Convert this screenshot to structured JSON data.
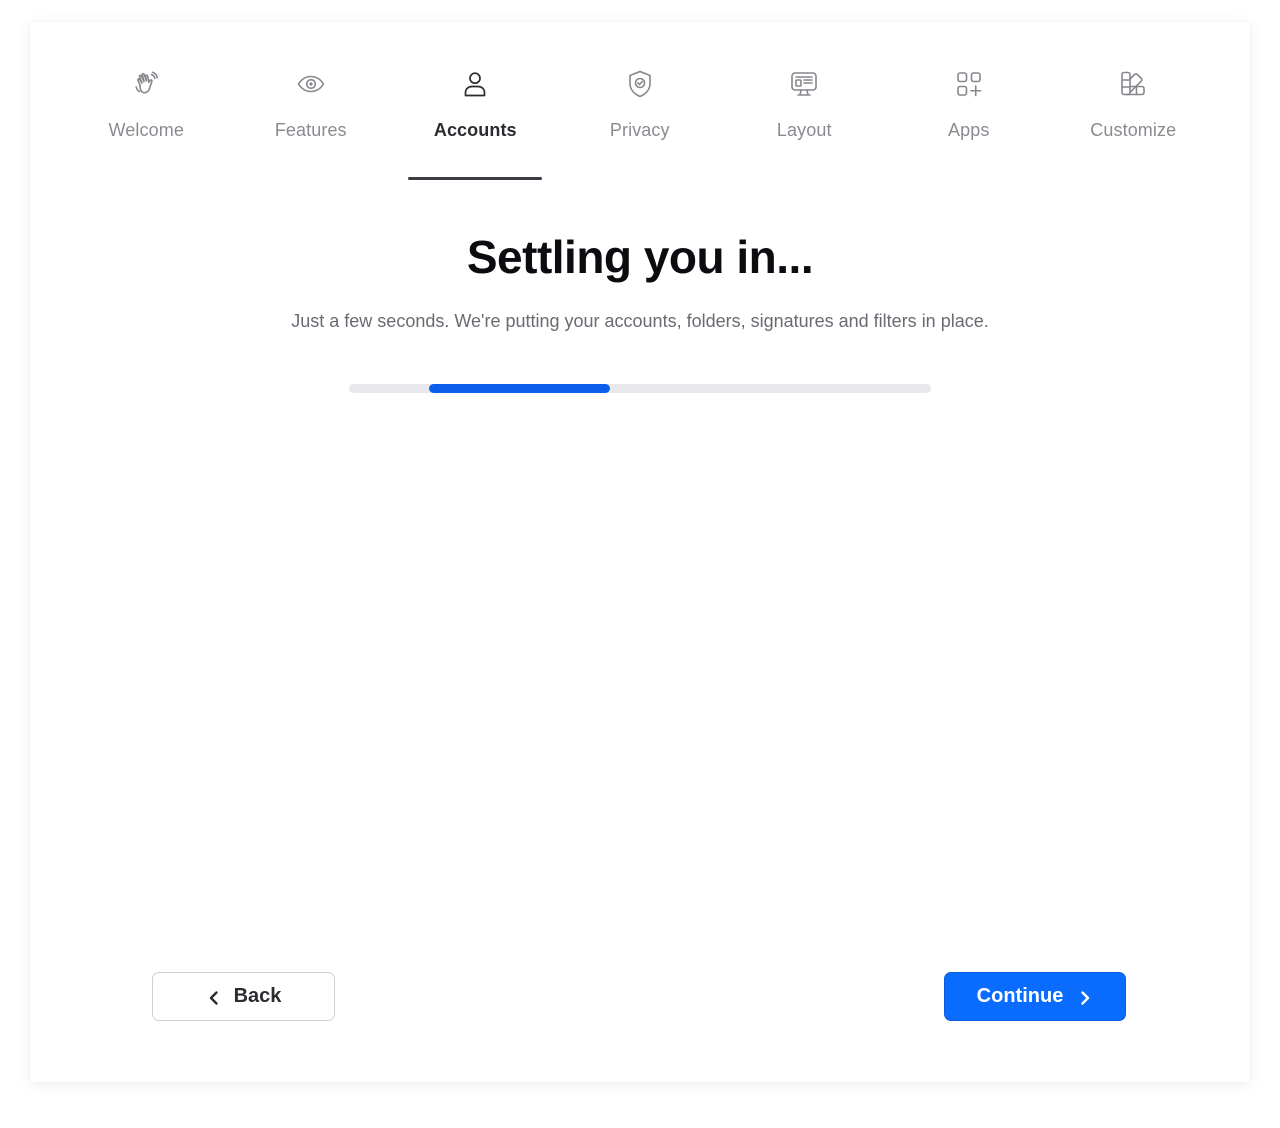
{
  "tabs": [
    {
      "label": "Welcome",
      "icon": "wave-hand-icon",
      "active": false
    },
    {
      "label": "Features",
      "icon": "eye-icon",
      "active": false
    },
    {
      "label": "Accounts",
      "icon": "user-icon",
      "active": true
    },
    {
      "label": "Privacy",
      "icon": "shield-check-icon",
      "active": false
    },
    {
      "label": "Layout",
      "icon": "layout-window-icon",
      "active": false
    },
    {
      "label": "Apps",
      "icon": "apps-grid-plus-icon",
      "active": false
    },
    {
      "label": "Customize",
      "icon": "palette-swatch-icon",
      "active": false
    }
  ],
  "main": {
    "title": "Settling you in...",
    "subtitle": "Just a few seconds. We're putting your accounts, folders, signatures and filters in place."
  },
  "progress": {
    "start_fraction": 0.138,
    "end_fraction": 0.448,
    "fill_color": "#0b5fea",
    "track_color": "#e8e8ec"
  },
  "footer": {
    "back_label": "Back",
    "continue_label": "Continue"
  },
  "colors": {
    "accent": "#0a6cff",
    "active_tab_text": "#2b2b30",
    "inactive_tab_text": "#8a8b91"
  }
}
